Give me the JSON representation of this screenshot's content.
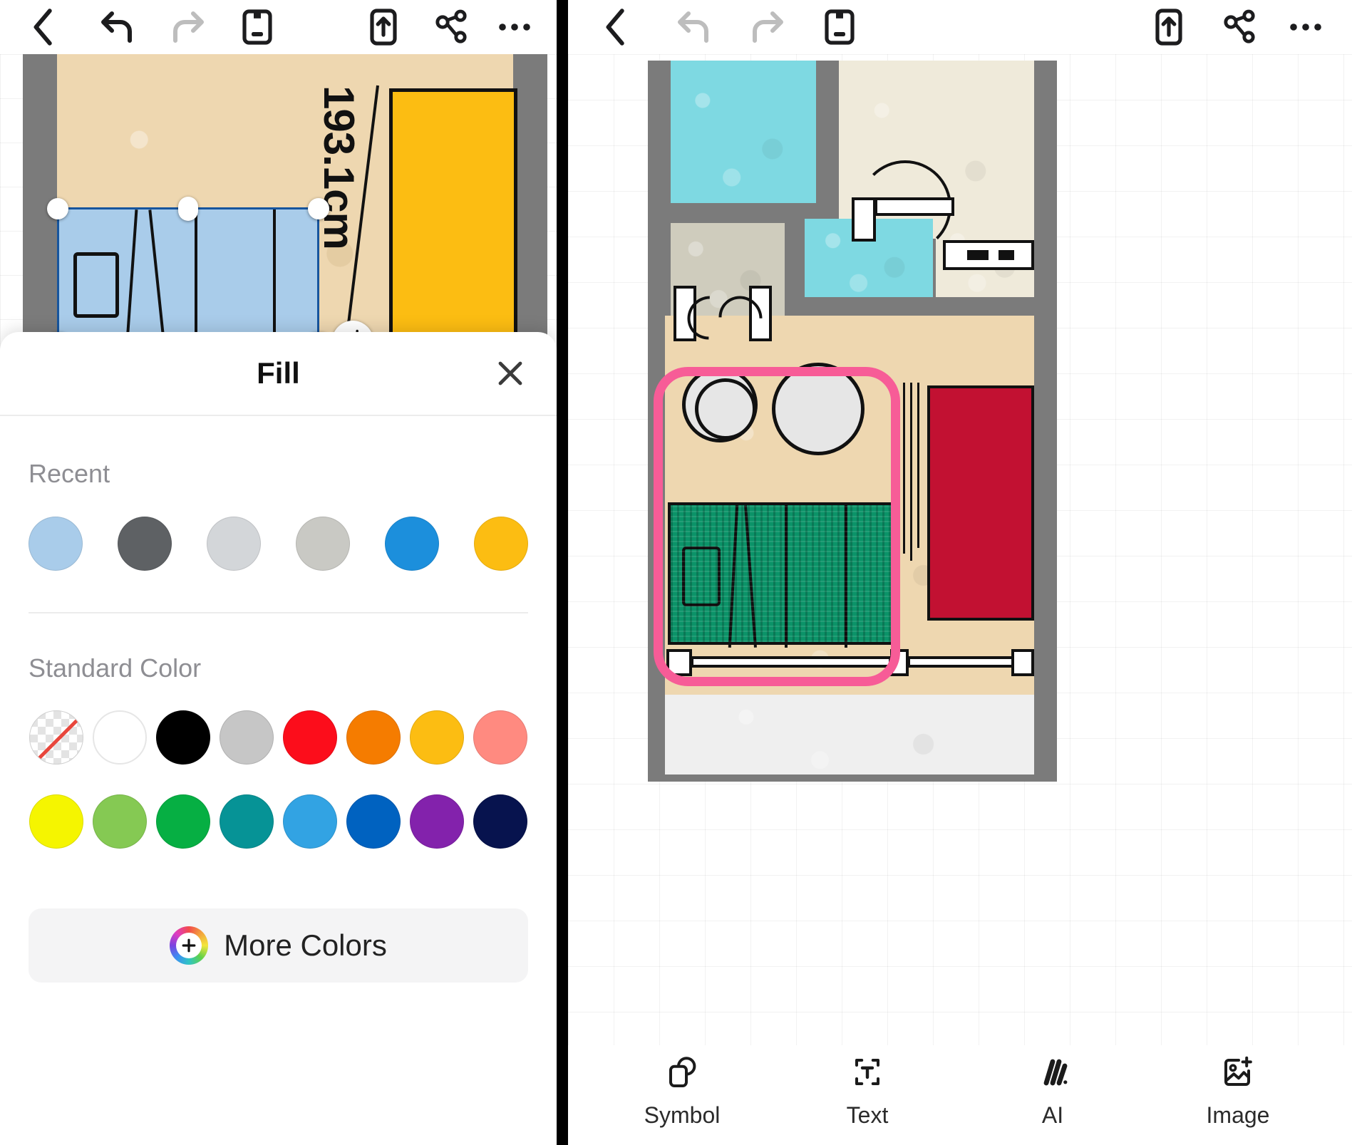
{
  "left_panel": {
    "toolbar": {
      "items": [
        {
          "name": "back-button",
          "icon": "chevron-left-icon",
          "state": "enabled"
        },
        {
          "name": "undo-button",
          "icon": "undo-arrow-icon",
          "state": "enabled"
        },
        {
          "name": "redo-button",
          "icon": "redo-arrow-icon",
          "state": "disabled"
        },
        {
          "name": "save-button",
          "icon": "floppy-disk-icon",
          "state": "enabled"
        },
        {
          "name": "export-button",
          "icon": "upload-box-icon",
          "state": "enabled"
        },
        {
          "name": "share-button",
          "icon": "share-nodes-icon",
          "state": "enabled"
        },
        {
          "name": "more-button",
          "icon": "ellipsis-icon",
          "state": "enabled"
        }
      ]
    },
    "canvas": {
      "dimension_label": "193.1cm",
      "selected_object": "bed",
      "selected_fill_color": "#A9CCEA",
      "floor_color": "#EED7B0",
      "wall_color": "#7B7B7B",
      "adjacent_object_color": "#FCBD12",
      "rotate_handle": "rotate-icon"
    },
    "fill_sheet": {
      "title": "Fill",
      "close_icon": "close-x-icon",
      "recent_label": "Recent",
      "recent_colors": [
        {
          "name": "light-blue",
          "hex": "#A9CCEA"
        },
        {
          "name": "dark-grey",
          "hex": "#5E6164"
        },
        {
          "name": "light-grey",
          "hex": "#D3D6D9"
        },
        {
          "name": "silver-grey",
          "hex": "#C9C9C4"
        },
        {
          "name": "blue",
          "hex": "#1C8FDC"
        },
        {
          "name": "amber",
          "hex": "#FCBD12"
        }
      ],
      "standard_label": "Standard Color",
      "standard_colors_row1": [
        {
          "name": "no-fill",
          "hex": "transparent"
        },
        {
          "name": "white",
          "hex": "#FFFFFF"
        },
        {
          "name": "black",
          "hex": "#000000"
        },
        {
          "name": "grey",
          "hex": "#C6C6C6"
        },
        {
          "name": "red",
          "hex": "#FC0D1B"
        },
        {
          "name": "orange",
          "hex": "#F57C00"
        },
        {
          "name": "amber",
          "hex": "#FCBD12"
        },
        {
          "name": "salmon",
          "hex": "#FF8A80"
        }
      ],
      "standard_colors_row2": [
        {
          "name": "yellow",
          "hex": "#F5F500"
        },
        {
          "name": "light-green",
          "hex": "#85C council"
        },
        {
          "name": "green",
          "hex": "#06AF43"
        },
        {
          "name": "teal",
          "hex": "#069396"
        },
        {
          "name": "sky-blue",
          "hex": "#32A3E3"
        },
        {
          "name": "blue",
          "hex": "#0062C0"
        },
        {
          "name": "purple",
          "hex": "#8322AC"
        },
        {
          "name": "navy",
          "hex": "#07134E"
        }
      ],
      "more_colors_label": "More Colors",
      "more_colors_icon": "color-wheel-plus-icon"
    }
  },
  "right_panel": {
    "toolbar": {
      "items": [
        {
          "name": "back-button",
          "icon": "chevron-left-icon",
          "state": "enabled"
        },
        {
          "name": "undo-button",
          "icon": "undo-arrow-icon",
          "state": "disabled"
        },
        {
          "name": "redo-button",
          "icon": "redo-arrow-icon",
          "state": "disabled"
        },
        {
          "name": "save-button",
          "icon": "floppy-disk-icon",
          "state": "enabled"
        },
        {
          "name": "export-button",
          "icon": "upload-box-icon",
          "state": "enabled"
        },
        {
          "name": "share-button",
          "icon": "share-nodes-icon",
          "state": "enabled"
        },
        {
          "name": "more-button",
          "icon": "ellipsis-icon",
          "state": "enabled"
        }
      ]
    },
    "canvas": {
      "highlight_color": "#F75C97",
      "wall_color": "#7B7B7B",
      "rooms": [
        {
          "name": "bathroom-top-left",
          "fill": "#7ED9E2"
        },
        {
          "name": "hallway-top-right",
          "fill": "#EFEADA"
        },
        {
          "name": "closet-mid-left",
          "fill": "#CFCCBD"
        },
        {
          "name": "bathroom-mid-right",
          "fill": "#7ED9E2"
        },
        {
          "name": "bedroom-main",
          "fill": "#EED7B0"
        },
        {
          "name": "balcony-bottom",
          "fill": "#EFEFEF"
        }
      ],
      "furniture": [
        {
          "name": "bed",
          "fill": "#0B9368"
        },
        {
          "name": "sofa",
          "fill": "#C21132"
        },
        {
          "name": "round-table",
          "fill": "#E6E6E6"
        },
        {
          "name": "chair",
          "fill": "#E6E6E6"
        }
      ]
    },
    "bottom_bar": {
      "items": [
        {
          "name": "symbol-tool",
          "label": "Symbol",
          "icon": "shapes-icon"
        },
        {
          "name": "text-tool",
          "label": "Text",
          "icon": "text-bracket-icon"
        },
        {
          "name": "ai-tool",
          "label": "AI",
          "icon": "ai-strokes-icon"
        },
        {
          "name": "image-tool",
          "label": "Image",
          "icon": "image-plus-icon"
        }
      ]
    }
  }
}
